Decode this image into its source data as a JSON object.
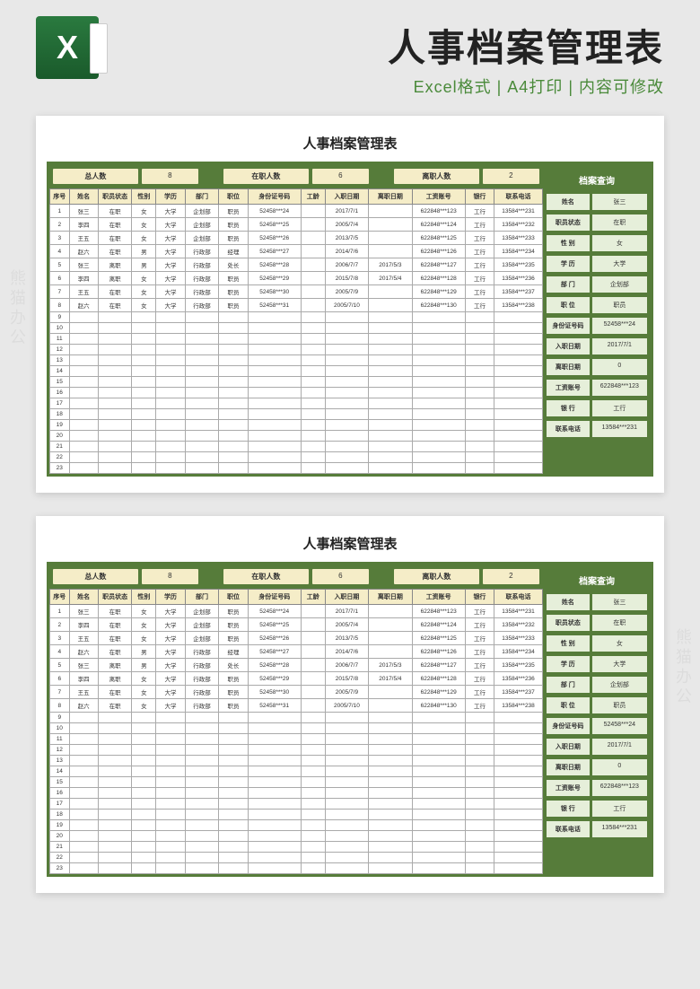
{
  "watermark": "熊猫办公",
  "header": {
    "title": "人事档案管理表",
    "subtitle": "Excel格式 | A4打印 | 内容可修改"
  },
  "sheet": {
    "title": "人事档案管理表",
    "summary": {
      "total_label": "总人数",
      "total_val": "8",
      "active_label": "在职人数",
      "active_val": "6",
      "left_label": "离职人数",
      "left_val": "2"
    },
    "columns": [
      "序号",
      "姓名",
      "职员状态",
      "性别",
      "学历",
      "部门",
      "职位",
      "身份证号码",
      "工龄",
      "入职日期",
      "离职日期",
      "工资账号",
      "银行",
      "联系电话"
    ],
    "rows": [
      [
        "1",
        "张三",
        "在职",
        "女",
        "大学",
        "企划部",
        "职员",
        "52458***24",
        "",
        "2017/7/1",
        "",
        "622848***123",
        "工行",
        "13584***231"
      ],
      [
        "2",
        "李四",
        "在职",
        "女",
        "大学",
        "企划部",
        "职员",
        "52458***25",
        "",
        "2005/7/4",
        "",
        "622848***124",
        "工行",
        "13584***232"
      ],
      [
        "3",
        "王五",
        "在职",
        "女",
        "大学",
        "企划部",
        "职员",
        "52458***26",
        "",
        "2013/7/5",
        "",
        "622848***125",
        "工行",
        "13584***233"
      ],
      [
        "4",
        "赵六",
        "在职",
        "男",
        "大学",
        "行政部",
        "经理",
        "52458***27",
        "",
        "2014/7/6",
        "",
        "622848***126",
        "工行",
        "13584***234"
      ],
      [
        "5",
        "张三",
        "离职",
        "男",
        "大学",
        "行政部",
        "处长",
        "52458***28",
        "",
        "2006/7/7",
        "2017/5/3",
        "622848***127",
        "工行",
        "13584***235"
      ],
      [
        "6",
        "李四",
        "离职",
        "女",
        "大学",
        "行政部",
        "职员",
        "52458***29",
        "",
        "2015/7/8",
        "2017/5/4",
        "622848***128",
        "工行",
        "13584***236"
      ],
      [
        "7",
        "王五",
        "在职",
        "女",
        "大学",
        "行政部",
        "职员",
        "52458***30",
        "",
        "2005/7/9",
        "",
        "622848***129",
        "工行",
        "13584***237"
      ],
      [
        "8",
        "赵六",
        "在职",
        "女",
        "大学",
        "行政部",
        "职员",
        "52458***31",
        "",
        "2005/7/10",
        "",
        "622848***130",
        "工行",
        "13584***238"
      ]
    ],
    "empty_start": 9,
    "empty_end": 23
  },
  "query": {
    "title": "档案查询",
    "fields": [
      {
        "label": "姓名",
        "val": "张三"
      },
      {
        "label": "职员状态",
        "val": "在职"
      },
      {
        "label": "性 别",
        "val": "女"
      },
      {
        "label": "学 历",
        "val": "大学"
      },
      {
        "label": "部 门",
        "val": "企划部"
      },
      {
        "label": "职 位",
        "val": "职员"
      },
      {
        "label": "身份证号码",
        "val": "52458***24"
      },
      {
        "label": "入职日期",
        "val": "2017/7/1"
      },
      {
        "label": "离职日期",
        "val": "0"
      },
      {
        "label": "工资账号",
        "val": "622848***123"
      },
      {
        "label": "银 行",
        "val": "工行"
      },
      {
        "label": "联系电话",
        "val": "13584***231"
      }
    ]
  }
}
